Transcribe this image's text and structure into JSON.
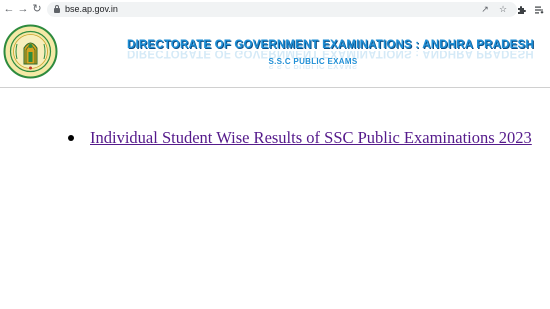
{
  "browser": {
    "url": "bse.ap.gov.in",
    "icons": {
      "back": "arrow-left-icon",
      "forward": "arrow-right-icon",
      "reload": "reload-icon",
      "lock": "lock-icon",
      "share": "share-icon",
      "bookmark": "star-icon",
      "extensions": "puzzle-icon",
      "reading_list": "reading-list-icon"
    }
  },
  "header": {
    "title": "DIRECTORATE OF GOVERNMENT EXAMINATIONS : ANDHRA PRADESH",
    "subtitle": "S.S.C PUBLIC EXAMS",
    "title_color": "#1f8fd6"
  },
  "main": {
    "links": [
      {
        "label": "Individual Student Wise Results of SSC Public Examinations 2023",
        "color": "#551a8b"
      }
    ]
  }
}
